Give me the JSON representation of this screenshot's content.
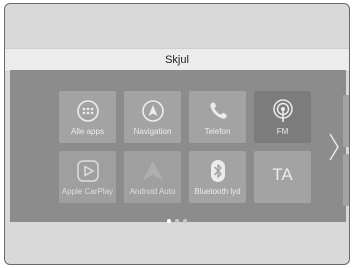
{
  "header": {
    "title": "Skjul"
  },
  "apps": [
    {
      "label": "Alle apps",
      "icon": "grid-icon"
    },
    {
      "label": "Navigation",
      "icon": "navigation-arrow-icon"
    },
    {
      "label": "Telefon",
      "icon": "phone-icon"
    },
    {
      "label": "FM",
      "icon": "radio-tower-icon"
    },
    {
      "label": "Apple CarPlay",
      "icon": "carplay-icon"
    },
    {
      "label": "Android Auto",
      "icon": "android-auto-icon"
    },
    {
      "label": "Bluetooth lyd",
      "icon": "bluetooth-icon"
    },
    {
      "label": "TA",
      "icon": ""
    }
  ],
  "pagination": {
    "pages": 3,
    "current": 1
  },
  "colors": {
    "panel": "#8c8c8c",
    "tile": "#a3a3a3",
    "active_tile": "#7c7c7c",
    "label": "#ececec"
  }
}
